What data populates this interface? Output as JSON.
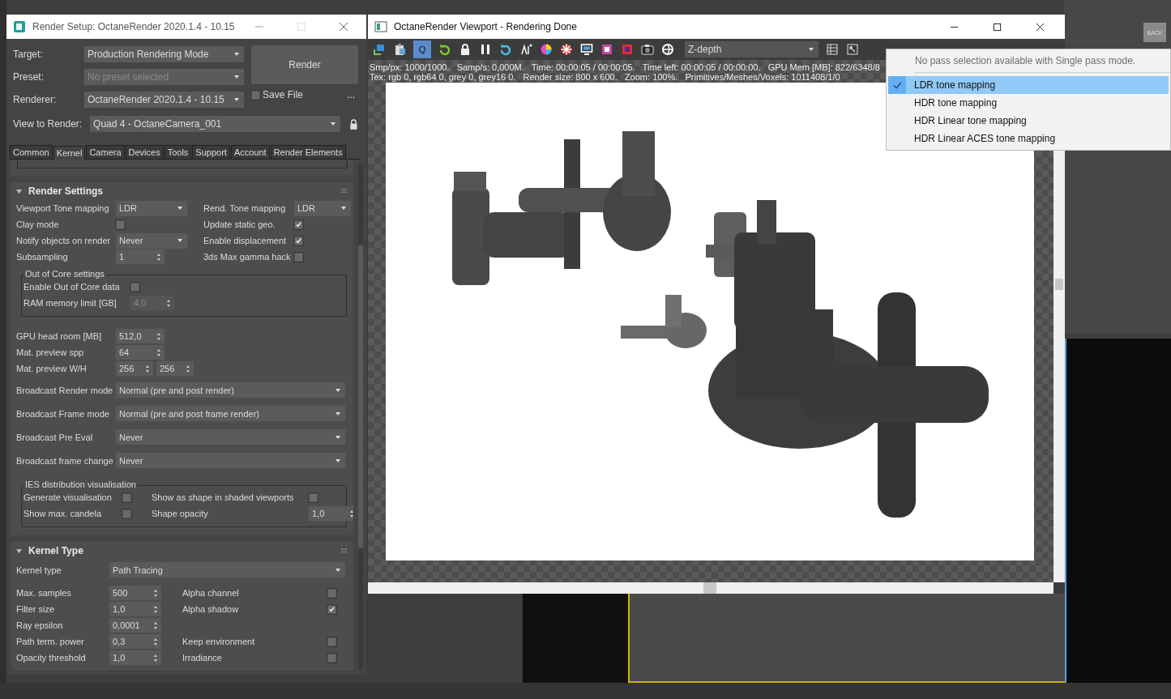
{
  "render_setup": {
    "title": "Render Setup: OctaneRender 2020.1.4 - 10.15",
    "target": {
      "label": "Target:",
      "value": "Production Rendering Mode",
      "disabled": false
    },
    "preset": {
      "label": "Preset:",
      "value": "No preset selected",
      "disabled": true
    },
    "renderer": {
      "label": "Renderer:",
      "value": "OctaneRender 2020.1.4 - 10.15",
      "disabled": false
    },
    "render_button": "Render",
    "save_file": {
      "label": "Save File",
      "checked": false
    },
    "more_button": "...",
    "view_to_render": {
      "label": "View to Render:",
      "value": "Quad 4 - OctaneCamera_001"
    },
    "tabs": [
      {
        "label": "Common",
        "selected": false
      },
      {
        "label": "Kernel",
        "selected": true
      },
      {
        "label": "Camera",
        "selected": false
      },
      {
        "label": "Devices",
        "selected": false
      },
      {
        "label": "Tools",
        "selected": false
      },
      {
        "label": "Support",
        "selected": false
      },
      {
        "label": "Account",
        "selected": false
      },
      {
        "label": "Render Elements",
        "selected": false
      }
    ],
    "rollouts": [
      {
        "title": "Render Settings",
        "expanded": true,
        "items": [
          {
            "kind": "row",
            "cells": [
              {
                "label": "Viewport Tone mapping",
                "kind": "dropdown",
                "value": "LDR"
              },
              {
                "label": "Rend. Tone mapping",
                "kind": "dropdown",
                "value": "LDR"
              }
            ]
          },
          {
            "kind": "row",
            "cells": [
              {
                "label": "Clay mode",
                "kind": "checkbox",
                "checked": false
              },
              {
                "label": "Update static geo.",
                "kind": "checkbox",
                "checked": true
              }
            ]
          },
          {
            "kind": "row",
            "cells": [
              {
                "label": "Notify objects on render",
                "kind": "dropdown",
                "value": "Never"
              },
              {
                "label": "Enable displacement",
                "kind": "checkbox",
                "checked": true
              }
            ]
          },
          {
            "kind": "row",
            "cells": [
              {
                "label": "Subsampling",
                "kind": "spinner",
                "value": "1",
                "disabled": false
              },
              {
                "label": "3ds Max gamma hack",
                "kind": "checkbox",
                "checked": false
              }
            ]
          },
          {
            "kind": "group",
            "title": "Out of Core settings",
            "rows": [
              {
                "cells": [
                  {
                    "label": "Enable Out of Core data",
                    "kind": "checkbox",
                    "checked": false
                  }
                ]
              },
              {
                "cells": [
                  {
                    "label": "RAM memory limit [GB]",
                    "kind": "spinner",
                    "value": "4,0",
                    "disabled": true
                  }
                ]
              }
            ]
          },
          {
            "kind": "row",
            "cells": [
              {
                "label": "GPU head room [MB]",
                "kind": "spinner",
                "value": "512,0",
                "disabled": false
              }
            ]
          },
          {
            "kind": "row",
            "cells": [
              {
                "label": "Mat. preview spp",
                "kind": "spinner",
                "value": "64",
                "disabled": false
              }
            ]
          },
          {
            "kind": "row",
            "cells": [
              {
                "label": "Mat. preview W/H",
                "kind": "spinner-pair",
                "values": [
                  "256",
                  "256"
                ]
              }
            ]
          },
          {
            "kind": "wide",
            "cells": [
              {
                "label": "Broadcast Render mode",
                "kind": "dropdown",
                "value": "Normal (pre and post render)"
              }
            ]
          },
          {
            "kind": "wide",
            "cells": [
              {
                "label": "Broadcast Frame mode",
                "kind": "dropdown",
                "value": "Normal (pre and post frame render)"
              }
            ]
          },
          {
            "kind": "wide",
            "cells": [
              {
                "label": "Broadcast Pre Eval",
                "kind": "dropdown",
                "value": "Never"
              }
            ]
          },
          {
            "kind": "wide",
            "cells": [
              {
                "label": "Broadcast frame change",
                "kind": "dropdown",
                "value": "Never"
              }
            ]
          },
          {
            "kind": "group",
            "title": "IES distribution visualisation",
            "rows": [
              {
                "cells": [
                  {
                    "label": "Generate visualisation",
                    "kind": "checkbox",
                    "checked": false
                  },
                  {
                    "label": "Show as shape in shaded viewports",
                    "kind": "checkbox",
                    "checked": false
                  }
                ]
              },
              {
                "cells": [
                  {
                    "label": "Show max. candela",
                    "kind": "checkbox",
                    "checked": false
                  },
                  {
                    "label": "Shape opacity",
                    "kind": "spinner",
                    "value": "1,0",
                    "disabled": false
                  }
                ]
              }
            ]
          }
        ]
      },
      {
        "title": "Kernel Type",
        "expanded": true,
        "items": [
          {
            "kind": "wide",
            "cells": [
              {
                "label": "Kernel type",
                "kind": "dropdown",
                "value": "Path Tracing"
              }
            ]
          },
          {
            "kind": "row",
            "cells": [
              {
                "label": "Max. samples",
                "kind": "spinner",
                "value": "500",
                "disabled": false
              },
              {
                "label": "Alpha channel",
                "kind": "checkbox",
                "checked": false
              }
            ]
          },
          {
            "kind": "row",
            "cells": [
              {
                "label": "Filter size",
                "kind": "spinner",
                "value": "1,0",
                "disabled": false
              },
              {
                "label": "Alpha shadow",
                "kind": "checkbox",
                "checked": true
              }
            ]
          },
          {
            "kind": "row",
            "cells": [
              {
                "label": "Ray epsilon",
                "kind": "spinner",
                "value": "0,0001",
                "disabled": false
              }
            ]
          },
          {
            "kind": "row",
            "cells": [
              {
                "label": "Path term. power",
                "kind": "spinner",
                "value": "0,3",
                "disabled": false
              },
              {
                "label": "Keep environment",
                "kind": "checkbox",
                "checked": false
              }
            ]
          },
          {
            "kind": "row",
            "cells": [
              {
                "label": "Opacity threshold",
                "kind": "spinner",
                "value": "1,0",
                "disabled": false
              },
              {
                "label": "Irradiance",
                "kind": "checkbox",
                "checked": false
              }
            ]
          }
        ]
      }
    ]
  },
  "viewport": {
    "title": "OctaneRender Viewport - Rendering Done",
    "quick_button": {
      "label": "Q",
      "on": true
    },
    "pass_dropdown": {
      "value": "Z-depth"
    },
    "stats": [
      "Smp/px: 1000/1000.   Samp/s: 0,000M.   Time: 00:00:05 / 00:00:05.   Time left: 00:00:05 / 00:00:00.   GPU Mem [MB]: 822/6348/8",
      "Tex: rgb 0, rgb64 0, grey 0, grey16 0.   Render size: 800 x 600.   Zoom: 100%.   Primitives/Meshes/Voxels: 1011408/1/0"
    ],
    "pass_menu": {
      "note": "No pass selection available with Single pass mode.",
      "items": [
        {
          "label": "LDR tone mapping",
          "selected": true
        },
        {
          "label": "HDR tone mapping",
          "selected": false
        },
        {
          "label": "HDR Linear tone mapping",
          "selected": false
        },
        {
          "label": "HDR Linear ACES tone mapping",
          "selected": false
        }
      ]
    }
  },
  "viewcube_label": "BACK"
}
